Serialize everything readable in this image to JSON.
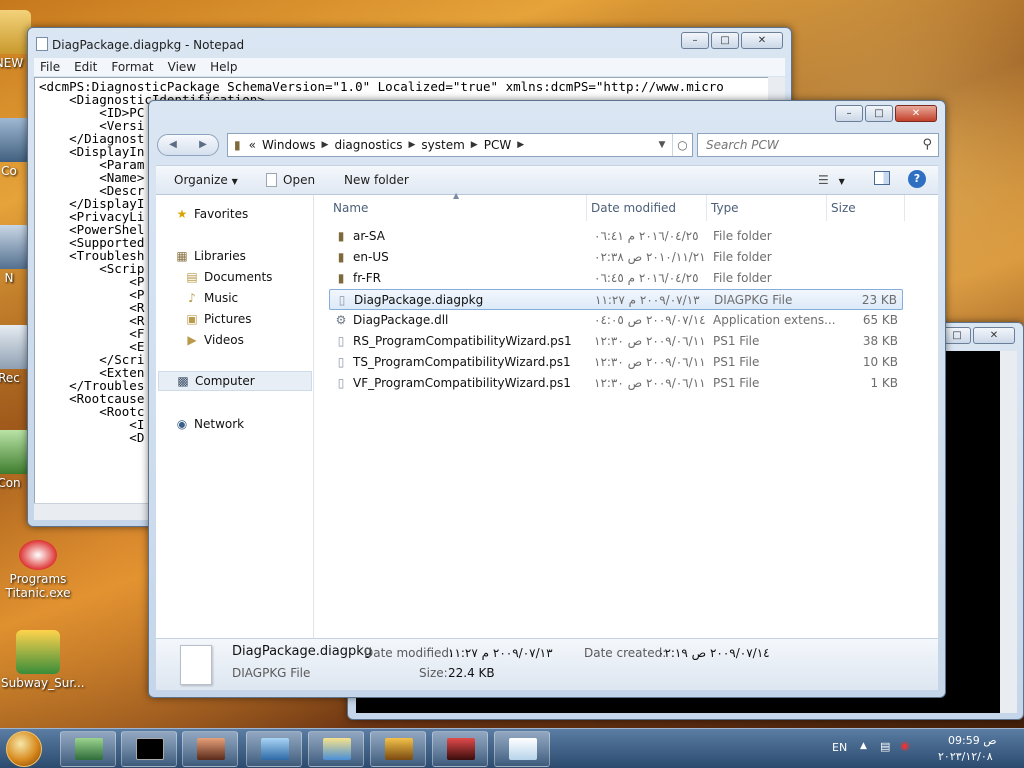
{
  "desktop": {
    "icons": [
      {
        "label": "NEW",
        "icon": "folder-icon"
      },
      {
        "label": "Co",
        "icon": "computer-icon"
      },
      {
        "label": "N",
        "icon": "network-icon"
      },
      {
        "label": "Rec",
        "icon": "recycle-bin-icon"
      },
      {
        "label": "Con",
        "icon": "control-panel-icon"
      },
      {
        "label": "Programs Titanic.exe",
        "icon": "program-icon"
      },
      {
        "label": "Subway_Sur...",
        "icon": "game-icon"
      }
    ]
  },
  "notepad": {
    "title": "DiagPackage.diagpkg - Notepad",
    "menu": [
      "File",
      "Edit",
      "Format",
      "View",
      "Help"
    ],
    "lines": [
      "<dcmPS:DiagnosticPackage SchemaVersion=\"1.0\" Localized=\"true\" xmlns:dcmPS=\"http://www.micro",
      "    <DiagnosticIdentification>",
      "        <ID>PC",
      "        <Versi",
      "    </Diagnost",
      "    <DisplayIn",
      "        <Param",
      "        <Name>",
      "        <Descr",
      "    </DisplayI",
      "    <PrivacyLi",
      "    <PowerShel",
      "    <Supported",
      "    <Troublesh",
      "        <Scrip",
      "            <P",
      "            <P",
      "            <R",
      "            <R",
      "            <F",
      "            <E",
      "        </Scri",
      "        <Exten",
      "    </Troubles",
      "    <Rootcause",
      "        <Rootc",
      "            <I",
      "            <D"
    ]
  },
  "explorer": {
    "breadcrumb": [
      "Windows",
      "diagnostics",
      "system",
      "PCW"
    ],
    "search_placeholder": "Search PCW",
    "toolbar": {
      "organize": "Organize",
      "open": "Open",
      "new_folder": "New folder"
    },
    "nav": {
      "favorites": "Favorites",
      "libraries": "Libraries",
      "documents": "Documents",
      "music": "Music",
      "pictures": "Pictures",
      "videos": "Videos",
      "computer": "Computer",
      "network": "Network"
    },
    "columns": {
      "name": "Name",
      "date": "Date modified",
      "type": "Type",
      "size": "Size"
    },
    "files": [
      {
        "name": "ar-SA",
        "date": "٢٠١٦/٠٤/٢٥ م ٠٦:٤١",
        "type": "File folder",
        "size": "",
        "icon": "folder-icon"
      },
      {
        "name": "en-US",
        "date": "٢٠١٠/١١/٢١ ص ٠٢:٣٨",
        "type": "File folder",
        "size": "",
        "icon": "folder-icon"
      },
      {
        "name": "fr-FR",
        "date": "٢٠١٦/٠٤/٢٥ م ٠٦:٤٥",
        "type": "File folder",
        "size": "",
        "icon": "folder-icon"
      },
      {
        "name": "DiagPackage.diagpkg",
        "date": "٢٠٠٩/٠٧/١٣ م ١١:٢٧",
        "type": "DIAGPKG File",
        "size": "23 KB",
        "icon": "file-icon"
      },
      {
        "name": "DiagPackage.dll",
        "date": "٢٠٠٩/٠٧/١٤ ص ٠٤:٠٥",
        "type": "Application extens...",
        "size": "65 KB",
        "icon": "dll-icon"
      },
      {
        "name": "RS_ProgramCompatibilityWizard.ps1",
        "date": "٢٠٠٩/٠٦/١١ ص ١٢:٣٠",
        "type": "PS1 File",
        "size": "38 KB",
        "icon": "file-icon"
      },
      {
        "name": "TS_ProgramCompatibilityWizard.ps1",
        "date": "٢٠٠٩/٠٦/١١ ص ١٢:٣٠",
        "type": "PS1 File",
        "size": "10 KB",
        "icon": "file-icon"
      },
      {
        "name": "VF_ProgramCompatibilityWizard.ps1",
        "date": "٢٠٠٩/٠٦/١١ ص ١٢:٣٠",
        "type": "PS1 File",
        "size": "1 KB",
        "icon": "file-icon"
      }
    ],
    "selected_index": 3,
    "details": {
      "name": "DiagPackage.diagpkg",
      "type": "DIAGPKG File",
      "modified_label": "Date modified:",
      "modified_value": "٢٠٠٩/٠٧/١٣ م ١١:٢٧",
      "created_label": "Date created:",
      "created_value": "٢٠٠٩/٠٧/١٤ ص ٠٢:١٩",
      "size_label": "Size:",
      "size_value": "22.4 KB"
    }
  },
  "taskbar": {
    "language": "EN",
    "time": "09:59 ص",
    "date": "٢٠٢٣/١٢/٠٨"
  }
}
